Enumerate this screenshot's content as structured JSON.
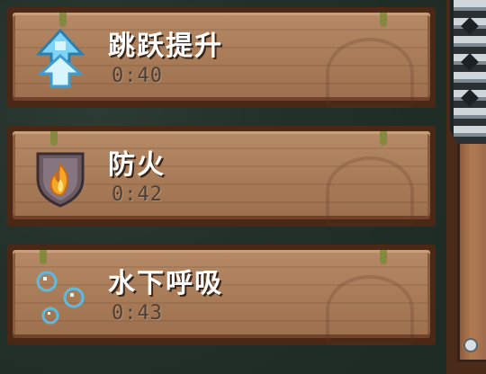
{
  "effects": [
    {
      "name": "跳跃提升",
      "time": "0:40",
      "icon": "jump-boost-icon"
    },
    {
      "name": "防火",
      "time": "0:42",
      "icon": "fire-resistance-icon"
    },
    {
      "name": "水下呼吸",
      "time": "0:43",
      "icon": "water-breathing-icon"
    }
  ]
}
